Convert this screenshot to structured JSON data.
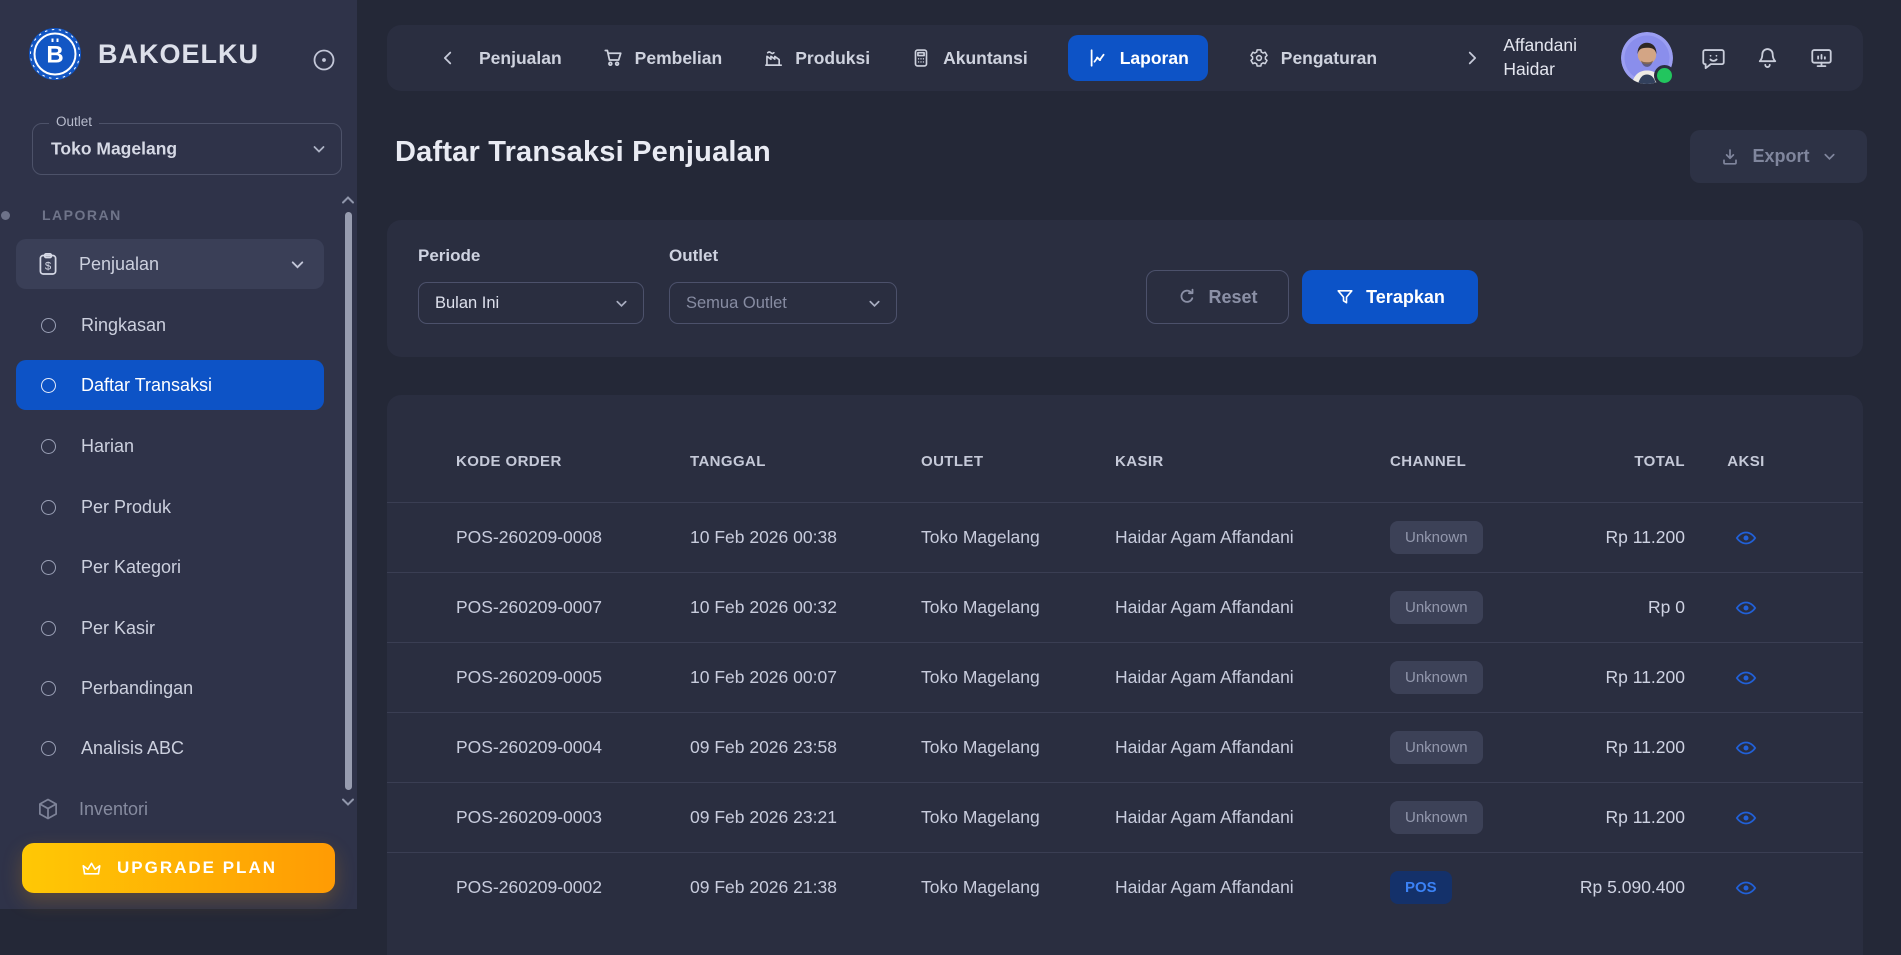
{
  "brand": {
    "name": "BAKOELKU"
  },
  "colors": {
    "accent_blue": "#0d53c6",
    "sidebar_bg": "#2f3349",
    "card_bg": "#2a2e40",
    "page_bg": "#242837",
    "upgrade_gradient_start": "#ffc805",
    "upgrade_gradient_end": "#ff9b04",
    "pos_badge_text": "#3b82f6",
    "online_green": "#22c55e"
  },
  "sidebar": {
    "outlet_label": "Outlet",
    "outlet_value": "Toko Magelang",
    "section_label": "LAPORAN",
    "items": [
      {
        "label": "Penjualan",
        "icon": "clipboard-dollar-icon",
        "expanded": true
      },
      {
        "label": "Ringkasan"
      },
      {
        "label": "Daftar Transaksi",
        "active": true
      },
      {
        "label": "Harian"
      },
      {
        "label": "Per Produk"
      },
      {
        "label": "Per Kategori"
      },
      {
        "label": "Per Kasir"
      },
      {
        "label": "Perbandingan"
      },
      {
        "label": "Analisis ABC"
      },
      {
        "label": "Inventori",
        "icon": "package-icon"
      }
    ],
    "upgrade_label": "UPGRADE PLAN"
  },
  "topnav": {
    "items": [
      {
        "label": "Penjualan",
        "icon": "chevron-left-icon"
      },
      {
        "label": "Pembelian",
        "icon": "cart-icon"
      },
      {
        "label": "Produksi",
        "icon": "factory-icon"
      },
      {
        "label": "Akuntansi",
        "icon": "calculator-icon"
      },
      {
        "label": "Laporan",
        "icon": "line-chart-icon",
        "active": true
      },
      {
        "label": "Pengaturan",
        "icon": "gear-icon"
      }
    ],
    "user": {
      "first_line": "Affandani",
      "second_line": "Haidar",
      "status": "online"
    }
  },
  "page": {
    "title": "Daftar Transaksi Penjualan"
  },
  "export": {
    "label": "Export"
  },
  "filters": {
    "periode": {
      "label": "Periode",
      "value": "Bulan Ini"
    },
    "outlet": {
      "label": "Outlet",
      "value": "Semua Outlet"
    },
    "reset_label": "Reset",
    "apply_label": "Terapkan"
  },
  "table": {
    "headers": [
      "KODE ORDER",
      "TANGGAL",
      "OUTLET",
      "KASIR",
      "CHANNEL",
      "TOTAL",
      "AKSI"
    ],
    "rows": [
      {
        "kode": "POS-260209-0008",
        "tanggal": "10 Feb 2026 00:38",
        "outlet": "Toko Magelang",
        "kasir": "Haidar Agam Affandani",
        "channel": "Unknown",
        "total": "Rp 11.200"
      },
      {
        "kode": "POS-260209-0007",
        "tanggal": "10 Feb 2026 00:32",
        "outlet": "Toko Magelang",
        "kasir": "Haidar Agam Affandani",
        "channel": "Unknown",
        "total": "Rp 0"
      },
      {
        "kode": "POS-260209-0005",
        "tanggal": "10 Feb 2026 00:07",
        "outlet": "Toko Magelang",
        "kasir": "Haidar Agam Affandani",
        "channel": "Unknown",
        "total": "Rp 11.200"
      },
      {
        "kode": "POS-260209-0004",
        "tanggal": "09 Feb 2026 23:58",
        "outlet": "Toko Magelang",
        "kasir": "Haidar Agam Affandani",
        "channel": "Unknown",
        "total": "Rp 11.200"
      },
      {
        "kode": "POS-260209-0003",
        "tanggal": "09 Feb 2026 23:21",
        "outlet": "Toko Magelang",
        "kasir": "Haidar Agam Affandani",
        "channel": "Unknown",
        "total": "Rp 11.200"
      },
      {
        "kode": "POS-260209-0002",
        "tanggal": "09 Feb 2026 21:38",
        "outlet": "Toko Magelang",
        "kasir": "Haidar Agam Affandani",
        "channel": "POS",
        "total": "Rp 5.090.400"
      }
    ]
  }
}
